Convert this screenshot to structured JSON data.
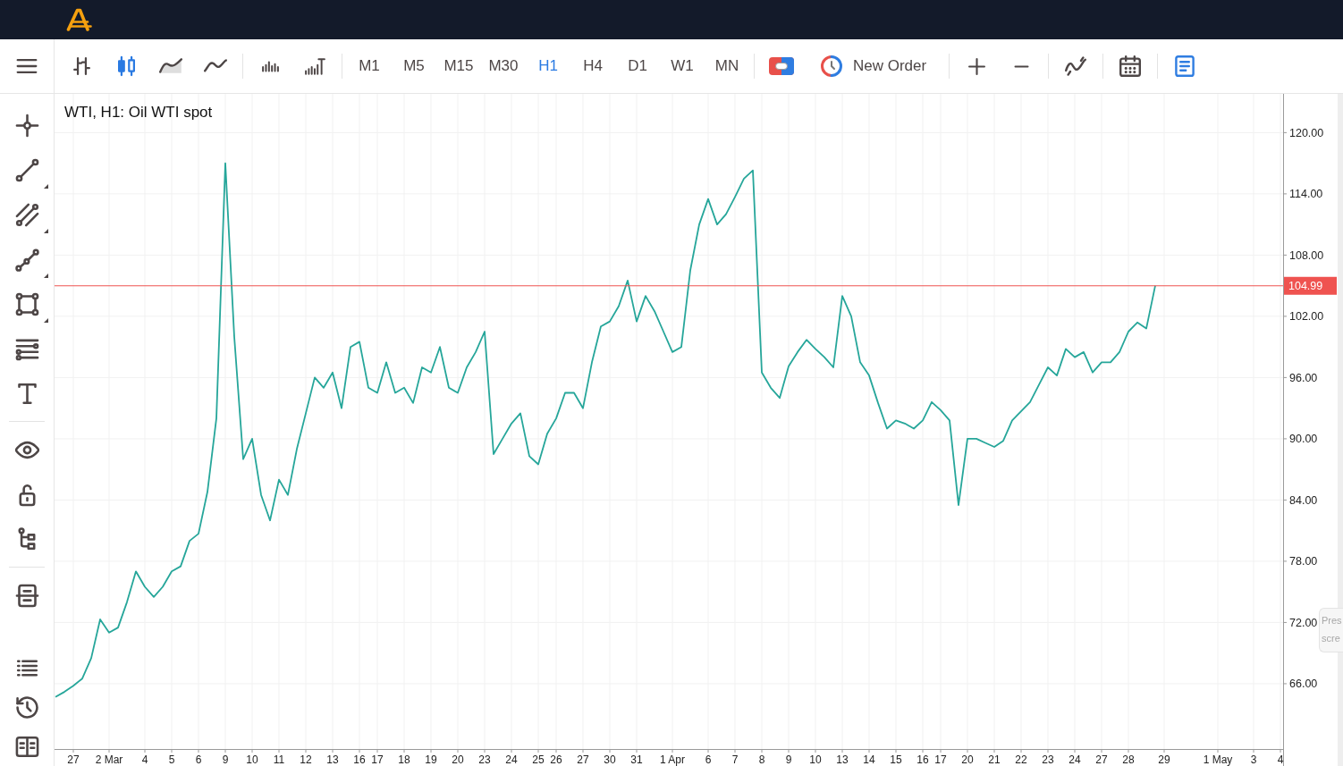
{
  "toolbar": {
    "chart_types": [
      {
        "kind": "bars",
        "selected": false
      },
      {
        "kind": "candles",
        "selected": true
      },
      {
        "kind": "area",
        "selected": false
      },
      {
        "kind": "line",
        "selected": false
      }
    ],
    "timeframes": [
      {
        "label": "M1",
        "selected": false
      },
      {
        "label": "M5",
        "selected": false
      },
      {
        "label": "M15",
        "selected": false
      },
      {
        "label": "M30",
        "selected": false
      },
      {
        "label": "H1",
        "selected": true
      },
      {
        "label": "H4",
        "selected": false
      },
      {
        "label": "D1",
        "selected": false
      },
      {
        "label": "W1",
        "selected": false
      },
      {
        "label": "MN",
        "selected": false
      }
    ],
    "new_order": {
      "label": "New Order"
    }
  },
  "chart": {
    "chart_data": {
      "type": "line",
      "title": "WTI, H1: Oil WTI spot",
      "grid": true,
      "categories": [
        null,
        null,
        "27",
        null,
        null,
        null,
        "2 Mar",
        null,
        null,
        null,
        "4",
        null,
        null,
        "5",
        null,
        null,
        "6",
        null,
        null,
        "9",
        null,
        null,
        "10",
        null,
        null,
        "11",
        null,
        null,
        "12",
        null,
        null,
        "13",
        null,
        null,
        "16",
        null,
        "17",
        null,
        null,
        "18",
        null,
        null,
        "19",
        null,
        null,
        "20",
        null,
        null,
        "23",
        null,
        null,
        "24",
        null,
        null,
        "25",
        null,
        "26",
        null,
        null,
        "27",
        null,
        null,
        "30",
        null,
        null,
        "31",
        null,
        null,
        null,
        "1 Apr",
        null,
        null,
        null,
        "6",
        null,
        null,
        "7",
        null,
        null,
        "8",
        null,
        null,
        "9",
        null,
        null,
        "10",
        null,
        null,
        "13",
        null,
        null,
        "14",
        null,
        null,
        "15",
        null,
        null,
        "16",
        null,
        "17",
        null,
        null,
        "20",
        null,
        null,
        "21",
        null,
        null,
        "22",
        null,
        null,
        "23",
        null,
        null,
        "24",
        null,
        null,
        "27",
        null,
        null,
        "28",
        null,
        null,
        null,
        "29",
        null,
        null,
        null,
        null,
        null,
        "1 May",
        null,
        null,
        null,
        "3",
        null,
        null,
        "4"
      ],
      "ylim": [
        59.6,
        123.8
      ],
      "yticks": [
        {
          "value": 120,
          "label": "120.00"
        },
        {
          "value": 114,
          "label": "114.00"
        },
        {
          "value": 108,
          "label": "108.00"
        },
        {
          "value": 102,
          "label": "102.00"
        },
        {
          "value": 96,
          "label": "96.00"
        },
        {
          "value": 90,
          "label": "90.00"
        },
        {
          "value": 84,
          "label": "84.00"
        },
        {
          "value": 78,
          "label": "78.00"
        },
        {
          "value": 72,
          "label": "72.00"
        },
        {
          "value": 66,
          "label": "66.00"
        }
      ],
      "series": [
        {
          "color": "#26a69a",
          "values": [
            64.7,
            65.2,
            65.8,
            66.5,
            68.5,
            72.3,
            71.0,
            71.5,
            74.0,
            77.0,
            75.5,
            74.5,
            75.5,
            77.0,
            77.5,
            80.0,
            80.7,
            84.8,
            92.0,
            117.0,
            100.0,
            88.0,
            90.0,
            84.5,
            82.0,
            86.0,
            84.5,
            89.0,
            92.5,
            96.0,
            95.0,
            96.5,
            93.0,
            99.0,
            99.5,
            95.0,
            94.5,
            97.5,
            94.5,
            95.0,
            93.5,
            97.0,
            96.5,
            99.0,
            95.0,
            94.5,
            97.0,
            98.5,
            100.5,
            88.5,
            90.0,
            91.5,
            92.5,
            88.3,
            87.5,
            90.5,
            92.0,
            94.5,
            94.5,
            93.0,
            97.5,
            101.0,
            101.5,
            103.0,
            105.5,
            101.5,
            104.0,
            102.5,
            100.5,
            98.5,
            99.0,
            106.5,
            111.0,
            113.5,
            111.0,
            112.0,
            113.7,
            115.5,
            116.3,
            96.5,
            95.0,
            94.0,
            97.1,
            98.5,
            99.7,
            98.8,
            98.0,
            97.0,
            104.0,
            102.0,
            97.5,
            96.2,
            93.5,
            91.0,
            91.8,
            91.5,
            91.0,
            91.8,
            93.6,
            92.8,
            91.8,
            83.5,
            90.0,
            90.0,
            89.6,
            89.2,
            89.8,
            91.8,
            92.7,
            93.6,
            95.3,
            97.0,
            96.2,
            98.8,
            98.0,
            98.5,
            96.5,
            97.5,
            97.5,
            98.5,
            100.5,
            101.4,
            100.8,
            105.0,
            null,
            null,
            null,
            null,
            null,
            null,
            null,
            null,
            null,
            null,
            null,
            null,
            null,
            null
          ]
        }
      ],
      "ref_lines": [
        {
          "axis": "y",
          "value": 104.99,
          "label": "104.99",
          "color": "#ef5350"
        }
      ]
    },
    "hint_popup": {
      "lines": [
        "Pres",
        "scre"
      ]
    }
  }
}
